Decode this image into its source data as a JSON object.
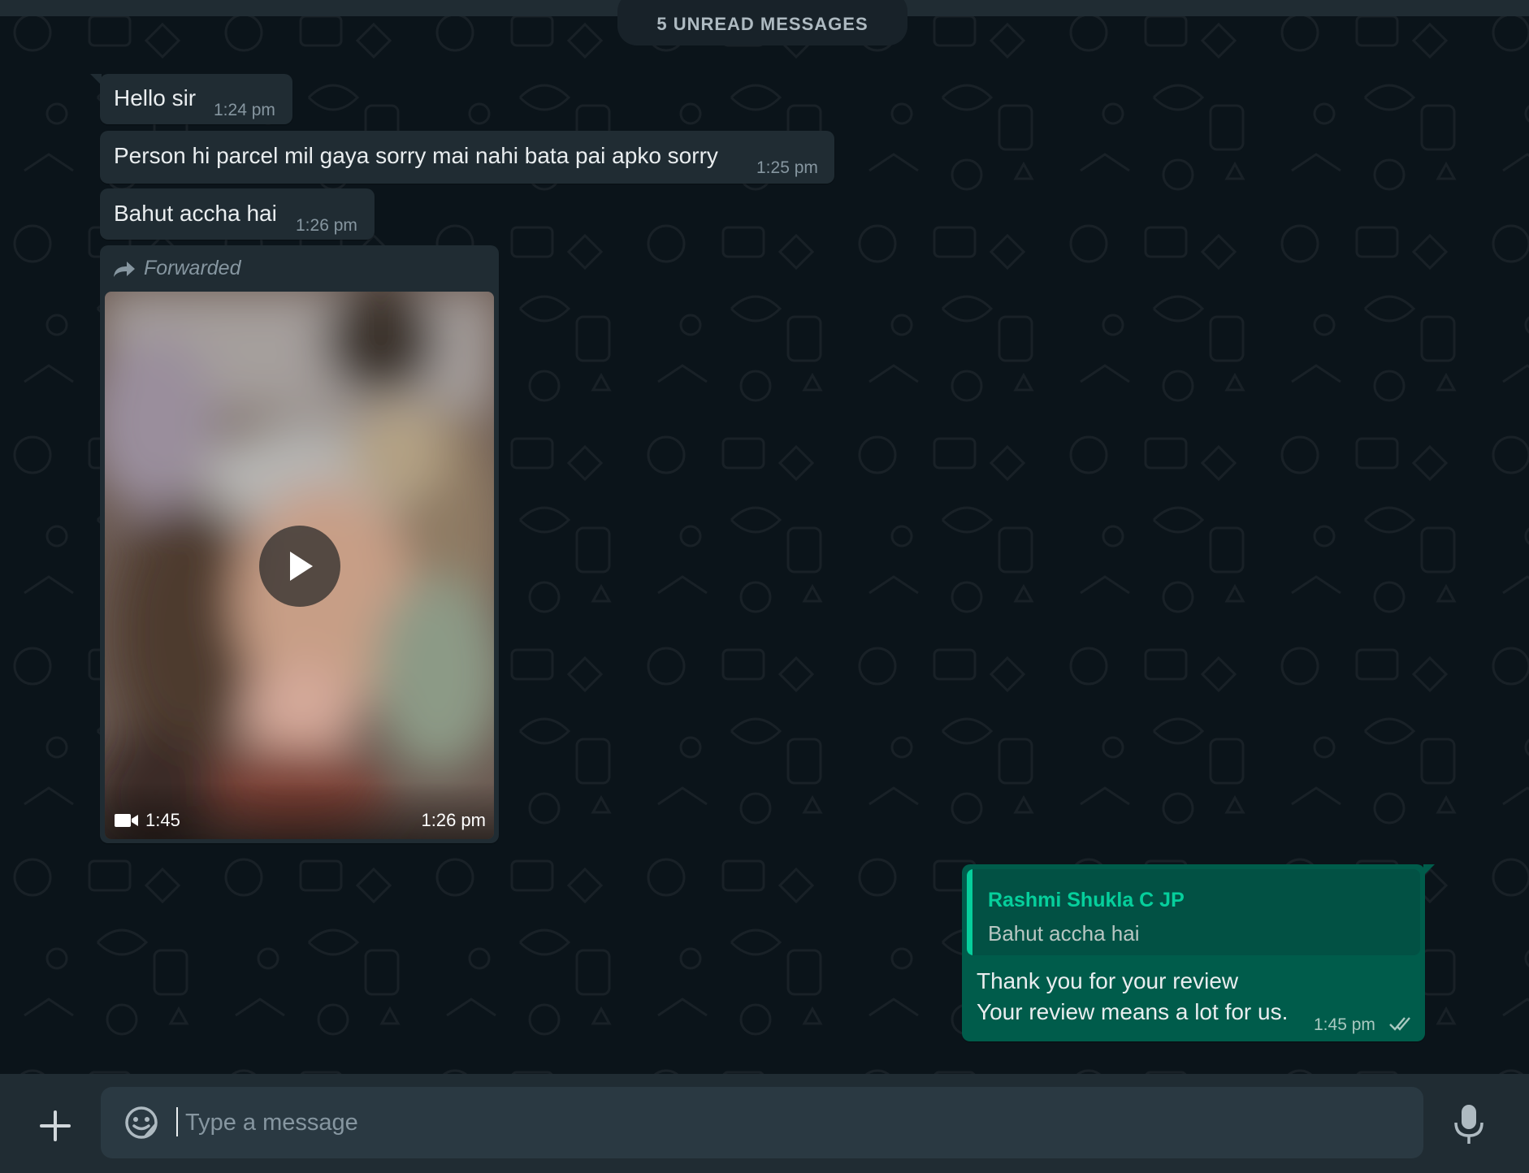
{
  "banner": {
    "unread_label": "5 UNREAD MESSAGES"
  },
  "messages": [
    {
      "direction": "incoming",
      "text": "Hello sir",
      "time": "1:24 pm"
    },
    {
      "direction": "incoming",
      "text": "Person hi parcel mil gaya sorry mai nahi bata pai apko sorry",
      "time": "1:25 pm"
    },
    {
      "direction": "incoming",
      "text": "Bahut accha hai",
      "time": "1:26 pm"
    },
    {
      "direction": "incoming",
      "type": "video",
      "forwarded_label": "Forwarded",
      "duration": "1:45",
      "time": "1:26 pm"
    },
    {
      "direction": "outgoing",
      "quote": {
        "author": "Rashmi Shukla C JP",
        "text": "Bahut accha hai"
      },
      "lines": [
        "Thank you for your review",
        "Your review means a lot for us."
      ],
      "time": "1:45 pm",
      "status": "read-double-tick-icon"
    }
  ],
  "composer": {
    "placeholder": "Type a message",
    "value": "",
    "attach_icon": "plus-icon",
    "sticker_icon": "sticker-icon",
    "mic_icon": "microphone-icon"
  },
  "colors": {
    "background": "#0b141a",
    "incoming_bubble": "#202c33",
    "outgoing_bubble": "#005c4b",
    "quote_accent": "#06cf9c",
    "footer": "#202c33",
    "input": "#2a3942",
    "secondary_text": "#8696a0"
  }
}
